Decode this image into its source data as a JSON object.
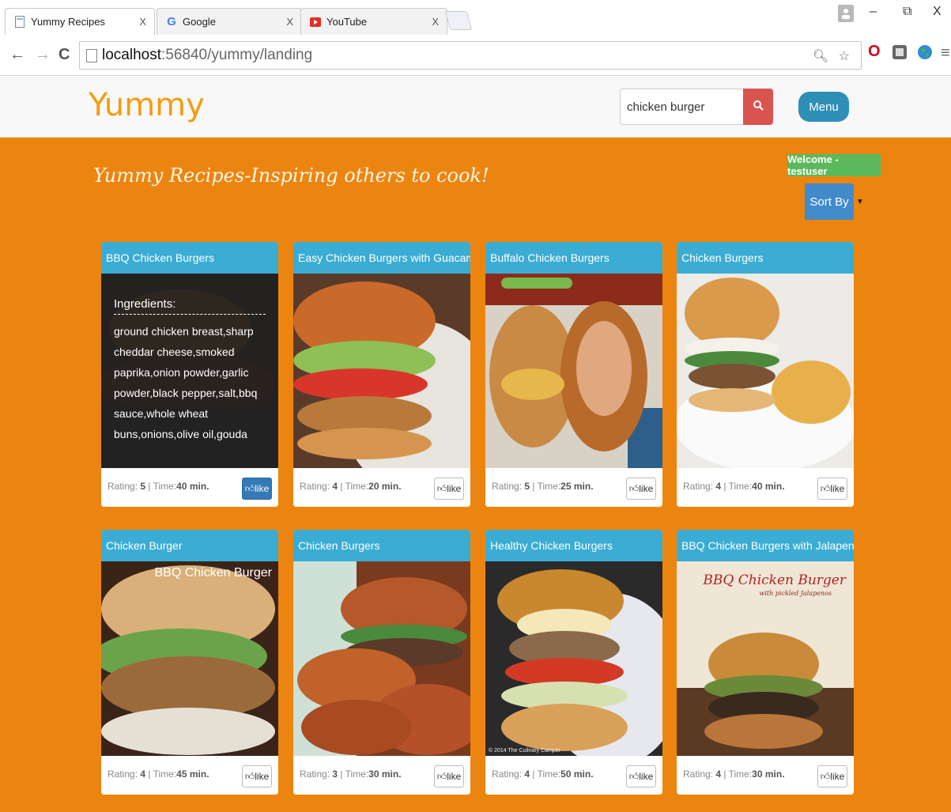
{
  "browser": {
    "tabs": [
      {
        "title": "Yummy Recipes",
        "close": "X",
        "icon": "page-icon"
      },
      {
        "title": "Google",
        "close": "X",
        "icon": "google-icon"
      },
      {
        "title": "YouTube",
        "close": "X",
        "icon": "youtube-icon"
      }
    ],
    "window_controls": {
      "minimize": "–",
      "restore": "⧉",
      "close": "X"
    },
    "url_host": "localhost",
    "url_rest": ":56840/yummy/landing"
  },
  "header": {
    "brand": "Yummy",
    "search_value": "chicken burger",
    "menu_label": "Menu"
  },
  "main": {
    "tagline": "Yummy Recipes-Inspiring others to cook!",
    "welcome": "Welcome - testuser",
    "sort_label": "Sort By"
  },
  "labels": {
    "rating": "Rating: ",
    "time": " | Time:",
    "like": "like",
    "ingredients_heading": "Ingredients:"
  },
  "recipes": [
    {
      "title": "BBQ Chicken Burgers",
      "rating": "5",
      "time": "40 min.",
      "liked": true,
      "ingredients": "ground chicken breast,sharp cheddar cheese,smoked paprika,onion powder,garlic powder,black pepper,salt,bbq sauce,whole wheat buns,onions,olive oil,gouda"
    },
    {
      "title": "Easy Chicken Burgers with Guacamole",
      "rating": "4",
      "time": "20 min.",
      "liked": false
    },
    {
      "title": "Buffalo Chicken Burgers",
      "rating": "5",
      "time": "25 min.",
      "liked": false
    },
    {
      "title": "Chicken Burgers",
      "rating": "4",
      "time": "40 min.",
      "liked": false
    },
    {
      "title": "Chicken Burger",
      "rating": "4",
      "time": "45 min.",
      "liked": false,
      "image_caption": "BBQ Chicken Burger"
    },
    {
      "title": "Chicken Burgers",
      "rating": "3",
      "time": "30 min.",
      "liked": false
    },
    {
      "title": "Healthy Chicken Burgers",
      "rating": "4",
      "time": "50 min.",
      "liked": false,
      "image_credit": "© 2014 The Culinary Camper"
    },
    {
      "title": "BBQ Chicken Burgers with Jalapenos",
      "rating": "4",
      "time": "30 min.",
      "liked": false,
      "image_caption": "BBQ Chicken Burger",
      "image_subcaption": "with pickled Jalapenos"
    }
  ],
  "colors": {
    "accent_orange": "#ec8510",
    "brand_orange": "#f39c12",
    "card_header": "#3bacd3",
    "search_button": "#d9534f",
    "menu_button": "#2e8fb6",
    "welcome_badge": "#5cb85c",
    "sort_button": "#428bca",
    "like_active": "#337ab7"
  }
}
